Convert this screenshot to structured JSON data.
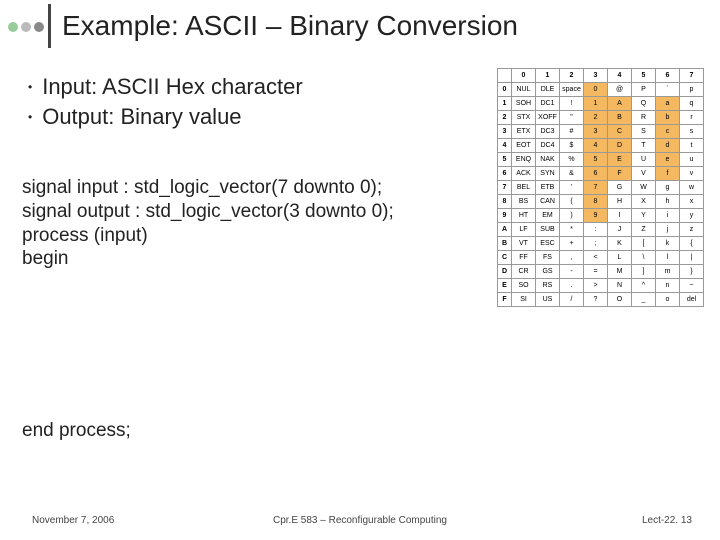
{
  "title": "Example: ASCII – Binary Conversion",
  "bullets": {
    "b1": "Input: ASCII Hex character",
    "b2": "Output: Binary value"
  },
  "code": {
    "l1": "signal input : std_logic_vector(7 downto 0);",
    "l2": "signal output : std_logic_vector(3 downto 0);",
    "l3": "process (input)",
    "l4": "begin",
    "end": "end process;"
  },
  "footer": {
    "date": "November 7, 2006",
    "mid": "Cpr.E 583 – Reconfigurable Computing",
    "right": "Lect-22. 13"
  },
  "ascii": {
    "cols": [
      "0",
      "1",
      "2",
      "3",
      "4",
      "5",
      "6",
      "7"
    ],
    "rows": [
      {
        "h": "0",
        "c": [
          "NUL",
          "DLE",
          "space",
          "0",
          "@",
          "P",
          "`",
          "p"
        ]
      },
      {
        "h": "1",
        "c": [
          "SOH",
          "DC1",
          "!",
          "1",
          "A",
          "Q",
          "a",
          "q"
        ]
      },
      {
        "h": "2",
        "c": [
          "STX",
          "XOFF",
          "\"",
          "2",
          "B",
          "R",
          "b",
          "r"
        ]
      },
      {
        "h": "3",
        "c": [
          "ETX",
          "DC3",
          "#",
          "3",
          "C",
          "S",
          "c",
          "s"
        ]
      },
      {
        "h": "4",
        "c": [
          "EOT",
          "DC4",
          "$",
          "4",
          "D",
          "T",
          "d",
          "t"
        ]
      },
      {
        "h": "5",
        "c": [
          "ENQ",
          "NAK",
          "%",
          "5",
          "E",
          "U",
          "e",
          "u"
        ]
      },
      {
        "h": "6",
        "c": [
          "ACK",
          "SYN",
          "&",
          "6",
          "F",
          "V",
          "f",
          "v"
        ]
      },
      {
        "h": "7",
        "c": [
          "BEL",
          "ETB",
          "'",
          "7",
          "G",
          "W",
          "g",
          "w"
        ]
      },
      {
        "h": "8",
        "c": [
          "BS",
          "CAN",
          "(",
          "8",
          "H",
          "X",
          "h",
          "x"
        ]
      },
      {
        "h": "9",
        "c": [
          "HT",
          "EM",
          ")",
          "9",
          "I",
          "Y",
          "i",
          "y"
        ]
      },
      {
        "h": "A",
        "c": [
          "LF",
          "SUB",
          "*",
          ":",
          "J",
          "Z",
          "j",
          "z"
        ]
      },
      {
        "h": "B",
        "c": [
          "VT",
          "ESC",
          "+",
          ";",
          "K",
          "[",
          "k",
          "{"
        ]
      },
      {
        "h": "C",
        "c": [
          "FF",
          "FS",
          ",",
          "<",
          "L",
          "\\",
          "l",
          "|"
        ]
      },
      {
        "h": "D",
        "c": [
          "CR",
          "GS",
          "-",
          "=",
          "M",
          "]",
          "m",
          "}"
        ]
      },
      {
        "h": "E",
        "c": [
          "SO",
          "RS",
          ".",
          ">",
          "N",
          "^",
          "n",
          "~"
        ]
      },
      {
        "h": "F",
        "c": [
          "SI",
          "US",
          "/",
          "?",
          "O",
          "_",
          "o",
          "del"
        ]
      }
    ],
    "hl": {
      "col3_rows": [
        0,
        1,
        2,
        3,
        4,
        5,
        6,
        7,
        8,
        9
      ],
      "col4_rows": [
        1,
        2,
        3,
        4,
        5,
        6
      ],
      "col6_rows": [
        1,
        2,
        3,
        4,
        5,
        6
      ]
    }
  }
}
